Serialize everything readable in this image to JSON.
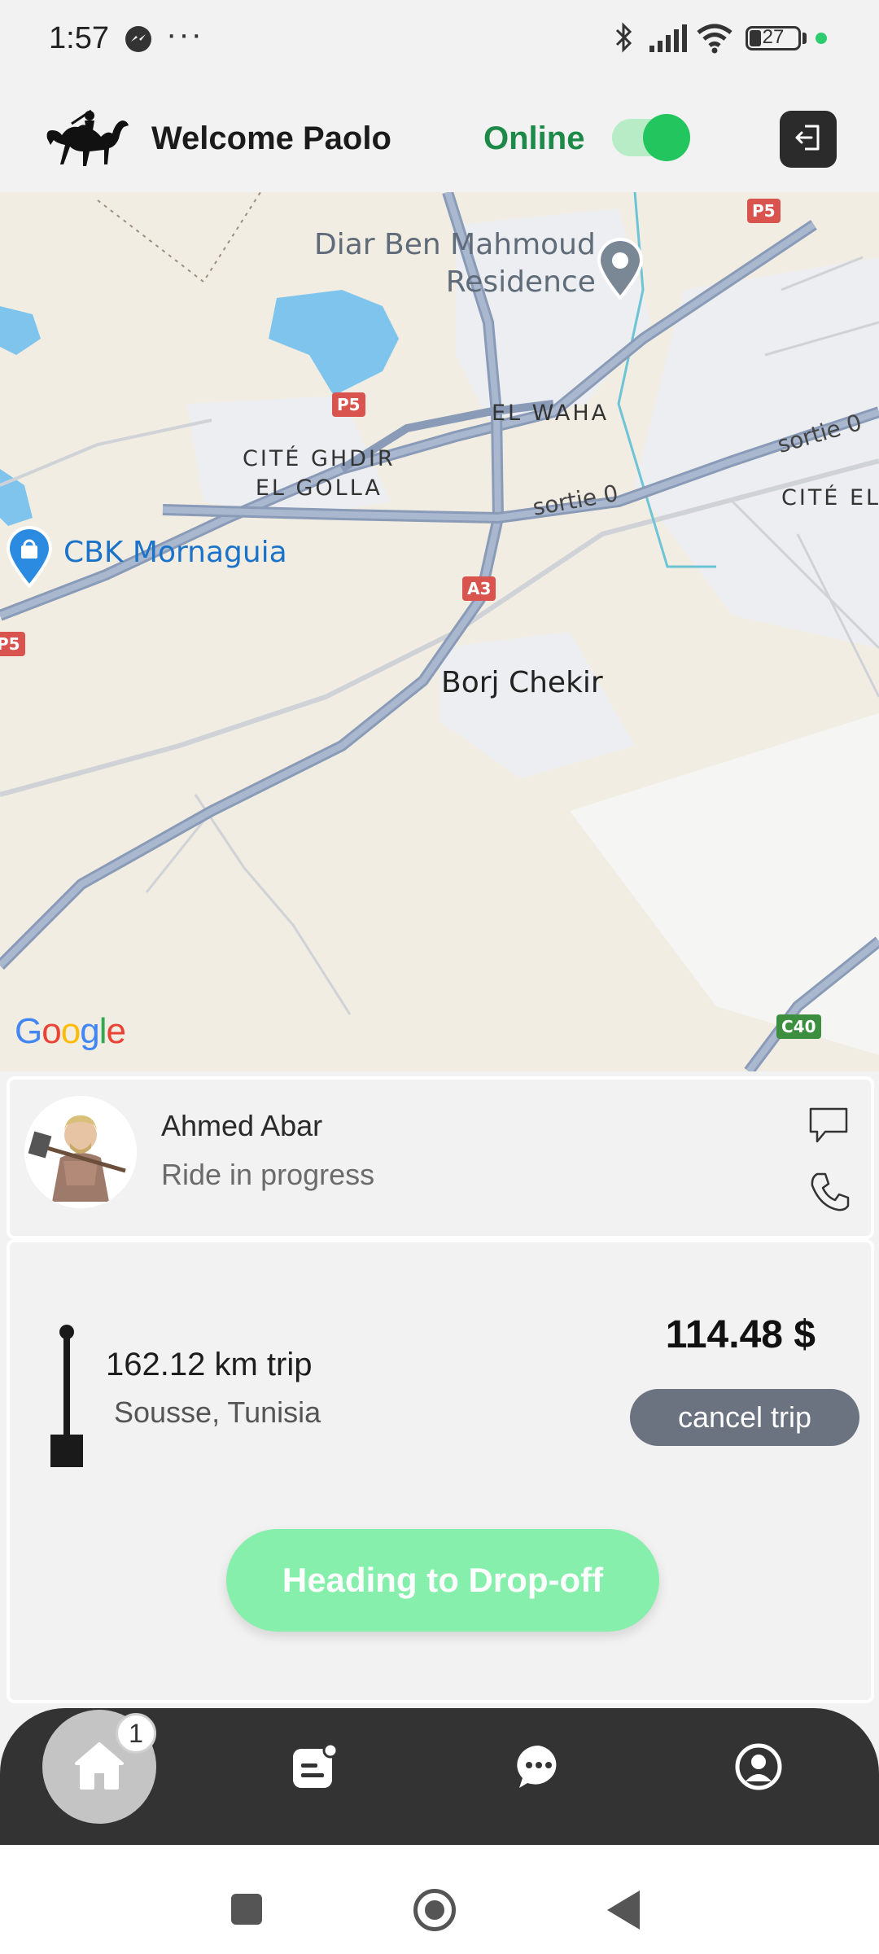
{
  "status_bar": {
    "time": "1:57",
    "more": "···",
    "battery": "27",
    "icons": [
      "messenger-icon",
      "bluetooth-icon",
      "signal-icon",
      "wifi-icon",
      "battery-icon"
    ]
  },
  "header": {
    "welcome": "Welcome Paolo",
    "online_label": "Online",
    "online": true,
    "accent_color": "#1e8a4a"
  },
  "map": {
    "labels": {
      "diar_line1": "Diar Ben Mahmoud",
      "diar_line2": "Residence",
      "el_waha": "EL WAHA",
      "cite_ghdir_line1": "CITÉ GHDIR",
      "cite_ghdir_line2": "EL GOLLA",
      "cite_el": "CITÉ EL",
      "cbk": "CBK Mornaguia",
      "borj": "Borj Chekir",
      "sortie_1": "sortie 0",
      "sortie_2": "sortie 0"
    },
    "road_badges": {
      "p5_top": "P5",
      "p5_mid": "P5",
      "p5_left": "P5",
      "a3": "A3",
      "c40": "C40"
    },
    "attribution": "Google"
  },
  "rider": {
    "name": "Ahmed Abar",
    "status": "Ride in progress"
  },
  "trip": {
    "distance": "162.12 km trip",
    "destination": "Sousse, Tunisia",
    "price": "114.48 $",
    "cancel_label": "cancel trip",
    "status_button": "Heading to Drop-off",
    "status_color": "#86efac"
  },
  "nav": {
    "home_badge": "1",
    "items": [
      "home-icon",
      "orders-icon",
      "chat-icon",
      "profile-icon"
    ]
  }
}
